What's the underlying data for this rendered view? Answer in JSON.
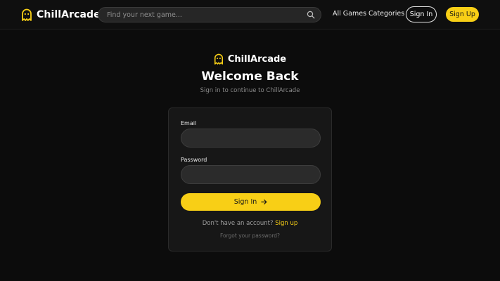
{
  "header": {
    "brand_name": "ChillArcade",
    "search": {
      "placeholder": "Find your next game...",
      "value": ""
    },
    "nav": {
      "all_games": "All Games",
      "categories": "Categories"
    },
    "sign_in_label": "Sign In",
    "sign_up_label": "Sign Up"
  },
  "hero": {
    "brand_name": "ChillArcade",
    "title": "Welcome Back",
    "subtitle": "Sign in to continue to ChillArcade"
  },
  "form": {
    "email_label": "Email",
    "email_value": "",
    "password_label": "Password",
    "password_value": "",
    "submit_label": "Sign In",
    "no_account_text": "Don't have an account?",
    "signup_link": "Sign up",
    "forgot_link": "Forgot your password?"
  },
  "icons": {
    "logo": "ghost-icon",
    "search": "search-icon",
    "submit": "arrow-right-icon"
  },
  "colors": {
    "background": "#0c0c0c",
    "accent": "#f8cf16",
    "card": "#171717",
    "input": "#2b2b2b"
  }
}
